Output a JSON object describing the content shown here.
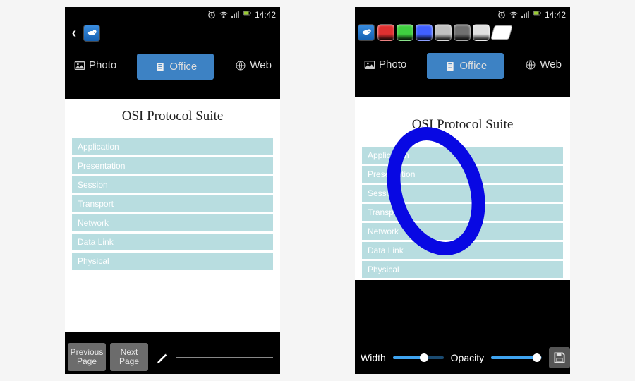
{
  "status": {
    "time": "14:42"
  },
  "nav": {
    "photo": "Photo",
    "office": "Office",
    "web": "Web"
  },
  "doc": {
    "title": "OSI Protocol Suite",
    "layers": [
      "Application",
      "Presentation",
      "Session",
      "Transport",
      "Network",
      "Data Link",
      "Physical"
    ]
  },
  "left_bottom": {
    "prev": "Previous Page",
    "next": "Next Page"
  },
  "right_bottom": {
    "width_label": "Width",
    "opacity_label": "Opacity",
    "width_pct": 62,
    "opacity_pct": 90
  },
  "palette": {
    "colors": [
      "#e03030",
      "#3fd040",
      "#4060ff",
      "#c0c0c0",
      "#707070",
      "#e0e0e0"
    ]
  },
  "annotation_color": "#0808e3"
}
